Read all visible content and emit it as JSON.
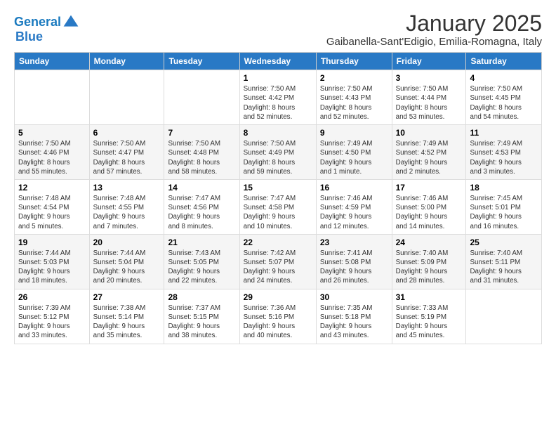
{
  "logo": {
    "line1": "General",
    "line2": "Blue"
  },
  "title": "January 2025",
  "subtitle": "Gaibanella-Sant'Edigio, Emilia-Romagna, Italy",
  "headers": [
    "Sunday",
    "Monday",
    "Tuesday",
    "Wednesday",
    "Thursday",
    "Friday",
    "Saturday"
  ],
  "weeks": [
    [
      {
        "day": "",
        "info": ""
      },
      {
        "day": "",
        "info": ""
      },
      {
        "day": "",
        "info": ""
      },
      {
        "day": "1",
        "info": "Sunrise: 7:50 AM\nSunset: 4:42 PM\nDaylight: 8 hours\nand 52 minutes."
      },
      {
        "day": "2",
        "info": "Sunrise: 7:50 AM\nSunset: 4:43 PM\nDaylight: 8 hours\nand 52 minutes."
      },
      {
        "day": "3",
        "info": "Sunrise: 7:50 AM\nSunset: 4:44 PM\nDaylight: 8 hours\nand 53 minutes."
      },
      {
        "day": "4",
        "info": "Sunrise: 7:50 AM\nSunset: 4:45 PM\nDaylight: 8 hours\nand 54 minutes."
      }
    ],
    [
      {
        "day": "5",
        "info": "Sunrise: 7:50 AM\nSunset: 4:46 PM\nDaylight: 8 hours\nand 55 minutes."
      },
      {
        "day": "6",
        "info": "Sunrise: 7:50 AM\nSunset: 4:47 PM\nDaylight: 8 hours\nand 57 minutes."
      },
      {
        "day": "7",
        "info": "Sunrise: 7:50 AM\nSunset: 4:48 PM\nDaylight: 8 hours\nand 58 minutes."
      },
      {
        "day": "8",
        "info": "Sunrise: 7:50 AM\nSunset: 4:49 PM\nDaylight: 8 hours\nand 59 minutes."
      },
      {
        "day": "9",
        "info": "Sunrise: 7:49 AM\nSunset: 4:50 PM\nDaylight: 9 hours\nand 1 minute."
      },
      {
        "day": "10",
        "info": "Sunrise: 7:49 AM\nSunset: 4:52 PM\nDaylight: 9 hours\nand 2 minutes."
      },
      {
        "day": "11",
        "info": "Sunrise: 7:49 AM\nSunset: 4:53 PM\nDaylight: 9 hours\nand 3 minutes."
      }
    ],
    [
      {
        "day": "12",
        "info": "Sunrise: 7:48 AM\nSunset: 4:54 PM\nDaylight: 9 hours\nand 5 minutes."
      },
      {
        "day": "13",
        "info": "Sunrise: 7:48 AM\nSunset: 4:55 PM\nDaylight: 9 hours\nand 7 minutes."
      },
      {
        "day": "14",
        "info": "Sunrise: 7:47 AM\nSunset: 4:56 PM\nDaylight: 9 hours\nand 8 minutes."
      },
      {
        "day": "15",
        "info": "Sunrise: 7:47 AM\nSunset: 4:58 PM\nDaylight: 9 hours\nand 10 minutes."
      },
      {
        "day": "16",
        "info": "Sunrise: 7:46 AM\nSunset: 4:59 PM\nDaylight: 9 hours\nand 12 minutes."
      },
      {
        "day": "17",
        "info": "Sunrise: 7:46 AM\nSunset: 5:00 PM\nDaylight: 9 hours\nand 14 minutes."
      },
      {
        "day": "18",
        "info": "Sunrise: 7:45 AM\nSunset: 5:01 PM\nDaylight: 9 hours\nand 16 minutes."
      }
    ],
    [
      {
        "day": "19",
        "info": "Sunrise: 7:44 AM\nSunset: 5:03 PM\nDaylight: 9 hours\nand 18 minutes."
      },
      {
        "day": "20",
        "info": "Sunrise: 7:44 AM\nSunset: 5:04 PM\nDaylight: 9 hours\nand 20 minutes."
      },
      {
        "day": "21",
        "info": "Sunrise: 7:43 AM\nSunset: 5:05 PM\nDaylight: 9 hours\nand 22 minutes."
      },
      {
        "day": "22",
        "info": "Sunrise: 7:42 AM\nSunset: 5:07 PM\nDaylight: 9 hours\nand 24 minutes."
      },
      {
        "day": "23",
        "info": "Sunrise: 7:41 AM\nSunset: 5:08 PM\nDaylight: 9 hours\nand 26 minutes."
      },
      {
        "day": "24",
        "info": "Sunrise: 7:40 AM\nSunset: 5:09 PM\nDaylight: 9 hours\nand 28 minutes."
      },
      {
        "day": "25",
        "info": "Sunrise: 7:40 AM\nSunset: 5:11 PM\nDaylight: 9 hours\nand 31 minutes."
      }
    ],
    [
      {
        "day": "26",
        "info": "Sunrise: 7:39 AM\nSunset: 5:12 PM\nDaylight: 9 hours\nand 33 minutes."
      },
      {
        "day": "27",
        "info": "Sunrise: 7:38 AM\nSunset: 5:14 PM\nDaylight: 9 hours\nand 35 minutes."
      },
      {
        "day": "28",
        "info": "Sunrise: 7:37 AM\nSunset: 5:15 PM\nDaylight: 9 hours\nand 38 minutes."
      },
      {
        "day": "29",
        "info": "Sunrise: 7:36 AM\nSunset: 5:16 PM\nDaylight: 9 hours\nand 40 minutes."
      },
      {
        "day": "30",
        "info": "Sunrise: 7:35 AM\nSunset: 5:18 PM\nDaylight: 9 hours\nand 43 minutes."
      },
      {
        "day": "31",
        "info": "Sunrise: 7:33 AM\nSunset: 5:19 PM\nDaylight: 9 hours\nand 45 minutes."
      },
      {
        "day": "",
        "info": ""
      }
    ]
  ]
}
